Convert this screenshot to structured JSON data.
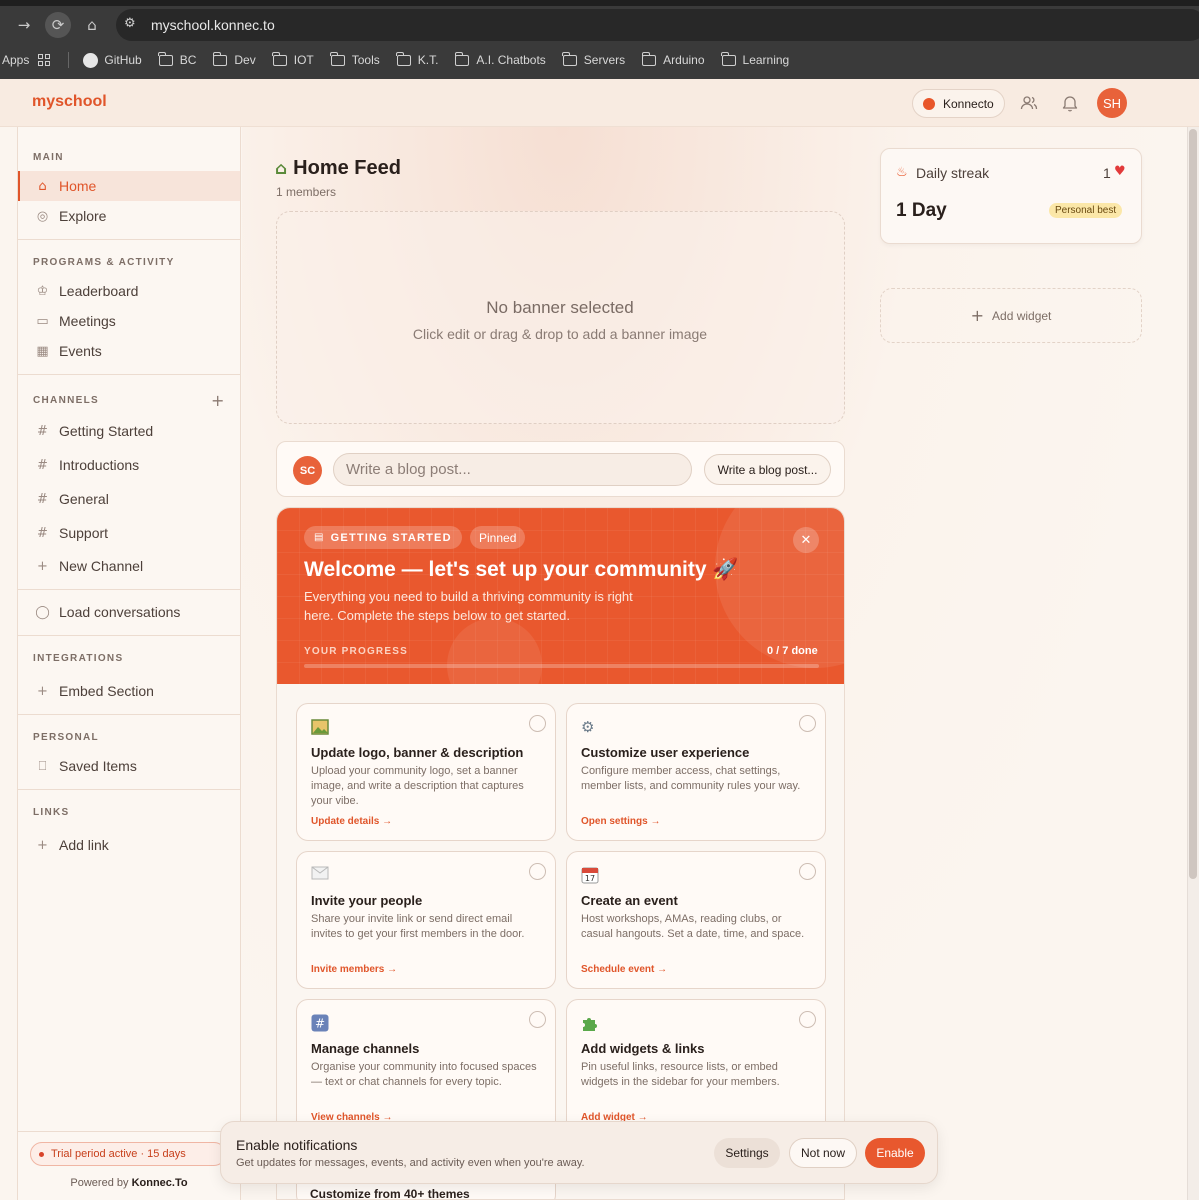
{
  "browser": {
    "url": "myschool.konnec.to",
    "bookmarks": [
      "Apps",
      "GitHub",
      "BC",
      "Dev",
      "IOT",
      "Tools",
      "K.T.",
      "A.I. Chatbots",
      "Servers",
      "Arduino",
      "Learning"
    ]
  },
  "header": {
    "brand": "myschool",
    "workspace": "Konnecto",
    "avatar_initials": "SH",
    "icons": [
      "members-icon",
      "bell-icon"
    ]
  },
  "sidebar": {
    "main_title": "MAIN",
    "main_items": [
      {
        "label": "Home",
        "icon": "home-icon"
      },
      {
        "label": "Explore",
        "icon": "globe-icon"
      }
    ],
    "programs_title": "PROGRAMS & ACTIVITY",
    "programs_items": [
      {
        "label": "Leaderboard",
        "icon": "trophy-icon"
      },
      {
        "label": "Meetings",
        "icon": "video-icon"
      },
      {
        "label": "Events",
        "icon": "calendar-icon"
      }
    ],
    "channels_title": "CHANNELS",
    "channels_items": [
      {
        "label": "Getting Started"
      },
      {
        "label": "Introductions"
      },
      {
        "label": "General"
      },
      {
        "label": "Support"
      },
      {
        "label": "New Channel"
      }
    ],
    "load_conversations": "Load conversations",
    "integrations_title": "INTEGRATIONS",
    "embed_section": "Embed Section",
    "personal_title": "PERSONAL",
    "saved_items": "Saved Items",
    "links_title": "LINKS",
    "add_link": "Add link",
    "trial": "Trial period active · 15 days",
    "powered_prefix": "Powered by",
    "powered_brand": "Konnec.To"
  },
  "feed": {
    "title": "Home Feed",
    "members": "1 members",
    "banner_title": "No banner selected",
    "banner_sub": "Click edit or drag & drop to add a banner image",
    "composer_avatar": "SC",
    "composer_placeholder": "Write a blog post...",
    "composer_button": "Write a blog post..."
  },
  "getting_started": {
    "badge": "GETTING STARTED",
    "pinned": "Pinned",
    "title": "Welcome — let's set up your community 🚀",
    "subtitle": "Everything you need to build a thriving community is right here. Complete the steps below to get started.",
    "progress_label": "YOUR PROGRESS",
    "progress_text": "0 / 7 done",
    "progress_fraction": 0,
    "tasks": [
      {
        "icon": "image-icon",
        "title": "Update logo, banner & description",
        "desc": "Upload your community logo, set a banner image, and write a description that captures your vibe.",
        "link": "Update details →"
      },
      {
        "icon": "gear-icon",
        "title": "Customize user experience",
        "desc": "Configure member access, chat settings, member lists, and community rules your way.",
        "link": "Open settings →"
      },
      {
        "icon": "envelope-icon",
        "title": "Invite your people",
        "desc": "Share your invite link or send direct email invites to get your first members in the door.",
        "link": "Invite members →"
      },
      {
        "icon": "calendar-icon",
        "title": "Create an event",
        "desc": "Host workshops, AMAs, reading clubs, or casual hangouts. Set a date, time, and space.",
        "link": "Schedule event →"
      },
      {
        "icon": "hash-icon",
        "title": "Manage channels",
        "desc": "Organise your community into focused spaces — text or chat channels for every topic.",
        "link": "View channels →"
      },
      {
        "icon": "puzzle-icon",
        "title": "Add widgets & links",
        "desc": "Pin useful links, resource lists, or embed widgets in the sidebar for your members.",
        "link": "Add widget →"
      }
    ],
    "next_task_title": "Customize from 40+ themes"
  },
  "right": {
    "streak_label": "Daily streak",
    "streak_count": "1",
    "streak_days": "1 Day",
    "personal_best": "Personal best",
    "add_widget": "Add widget"
  },
  "toast": {
    "title": "Enable notifications",
    "subtitle": "Get updates for messages, events, and activity even when you're away.",
    "settings": "Settings",
    "not_now": "Not now",
    "enable": "Enable"
  },
  "colors": {
    "accent": "#e0552a",
    "hero": "#e9582e"
  }
}
